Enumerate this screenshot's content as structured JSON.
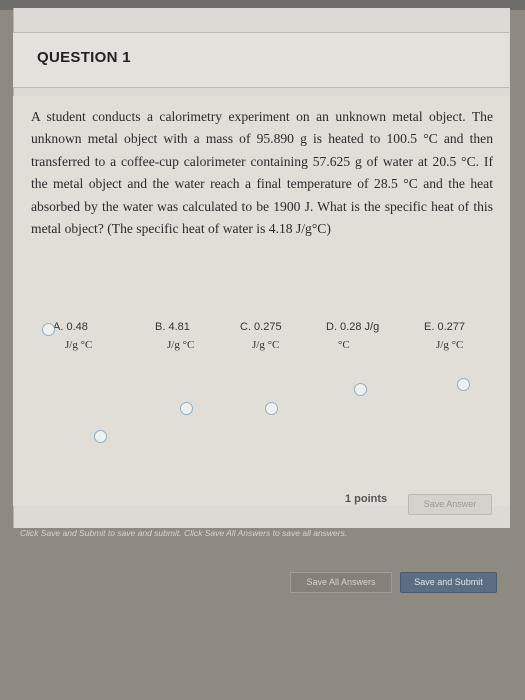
{
  "question": {
    "title": "QUESTION 1",
    "text": "A student conducts a calorimetry experiment on an unknown metal object. The unknown metal object with a mass of 95.890 g is heated to 100.5 °C and then transferred to a coffee-cup calorimeter containing 57.625 g of water at 20.5 °C. If the metal object and the water reach a final temperature of 28.5 °C and the heat absorbed by the water was calculated to be 1900 J. What is the specific heat of this metal object? (The specific heat of water is 4.18 J/g°C)"
  },
  "options": [
    {
      "label": "A. 0.48",
      "unit": "J/g °C"
    },
    {
      "label": "B. 4.81",
      "unit": "J/g °C"
    },
    {
      "label": "C. 0.275",
      "unit": "J/g °C"
    },
    {
      "label": "D. 0.28 J/g",
      "unit": "°C"
    },
    {
      "label": "E. 0.277",
      "unit": "J/g °C"
    }
  ],
  "points": "1 points",
  "buttons": {
    "save_answer": "Save Answer",
    "save_all": "Save All Answers",
    "save_submit": "Save and Submit"
  },
  "footer": {
    "help": "Click Save and Submit to save and submit. Click Save All Answers to save all answers."
  }
}
